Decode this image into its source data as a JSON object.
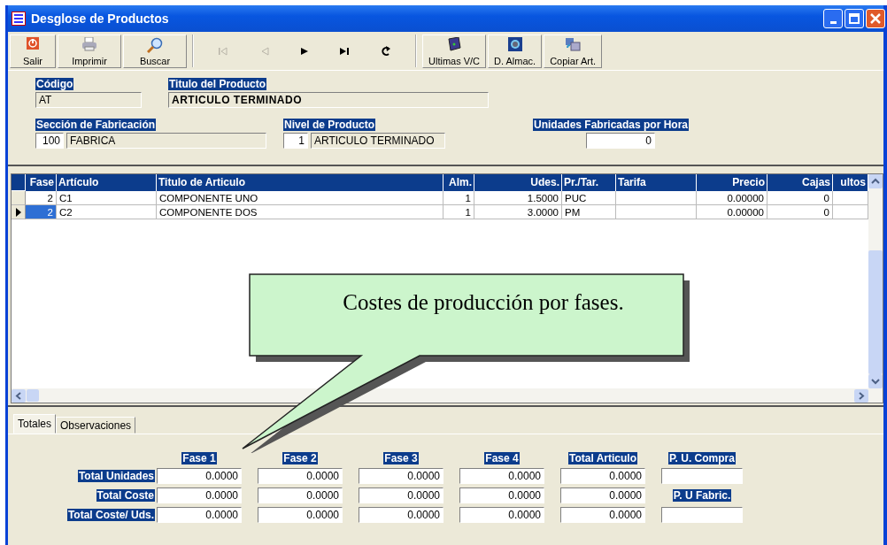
{
  "window": {
    "title": "Desglose de Productos"
  },
  "toolbar": [
    {
      "kind": "exit",
      "label": "Salir"
    },
    {
      "kind": "printer",
      "label": "Imprimir"
    },
    {
      "kind": "magnifier",
      "label": "Buscar"
    }
  ],
  "nav": [
    {
      "kind": "first",
      "disabled": true
    },
    {
      "kind": "prev",
      "disabled": true
    },
    {
      "kind": "next",
      "disabled": false
    },
    {
      "kind": "last",
      "disabled": false
    },
    {
      "kind": "refresh",
      "disabled": false
    }
  ],
  "toolbar2": [
    {
      "kind": "book",
      "label": "Ultimas V/C"
    },
    {
      "kind": "gauge",
      "label": "D. Almac."
    },
    {
      "kind": "copy",
      "label": "Copiar Art."
    }
  ],
  "form": {
    "codigo": {
      "label": "Código",
      "value": "AT"
    },
    "titulo": {
      "label": "Titulo del Producto",
      "value": "ARTICULO TERMINADO"
    },
    "seccion": {
      "label": "Sección de Fabricación",
      "code": "100",
      "value": "FABRICA"
    },
    "nivel": {
      "label": "Nivel de Producto",
      "code": "1",
      "value": "ARTICULO TERMINADO"
    },
    "unidades": {
      "label": "Unidades Fabricadas por Hora",
      "value": "0"
    }
  },
  "table": {
    "columns": [
      "Fase",
      "Artículo",
      "Titulo de Articulo",
      "Alm.",
      "Udes.",
      "Pr./Tar.",
      "Tarifa",
      "Precio",
      "Cajas",
      "ultos"
    ],
    "rows": [
      {
        "selected": false,
        "cells": [
          "2",
          "C1",
          "COMPONENTE UNO",
          "1",
          "1.5000",
          "PUC",
          "",
          "0.00000",
          "0",
          ""
        ]
      },
      {
        "selected": true,
        "cells": [
          "2",
          "C2",
          "COMPONENTE DOS",
          "1",
          "3.0000",
          "PM",
          "",
          "0.00000",
          "0",
          ""
        ]
      }
    ]
  },
  "callout": {
    "text": "Costes de producción por fases."
  },
  "tabs": [
    {
      "label": "Totales",
      "selected": true
    },
    {
      "label": "Observaciones",
      "selected": false
    }
  ],
  "totals": {
    "columns": [
      "Fase 1",
      "Fase 2",
      "Fase 3",
      "Fase 4",
      "Total Articulo"
    ],
    "rows": [
      {
        "label": "Total Unidades",
        "values": [
          "0.0000",
          "0.0000",
          "0.0000",
          "0.0000",
          "0.0000"
        ]
      },
      {
        "label": "Total Coste",
        "values": [
          "0.0000",
          "0.0000",
          "0.0000",
          "0.0000",
          "0.0000"
        ]
      },
      {
        "label": "Total Coste/ Uds.",
        "values": [
          "0.0000",
          "0.0000",
          "0.0000",
          "0.0000",
          "0.0000"
        ]
      }
    ],
    "side": [
      {
        "label": "P. U. Compra"
      },
      {
        "label": "P. U Fabric."
      }
    ]
  }
}
